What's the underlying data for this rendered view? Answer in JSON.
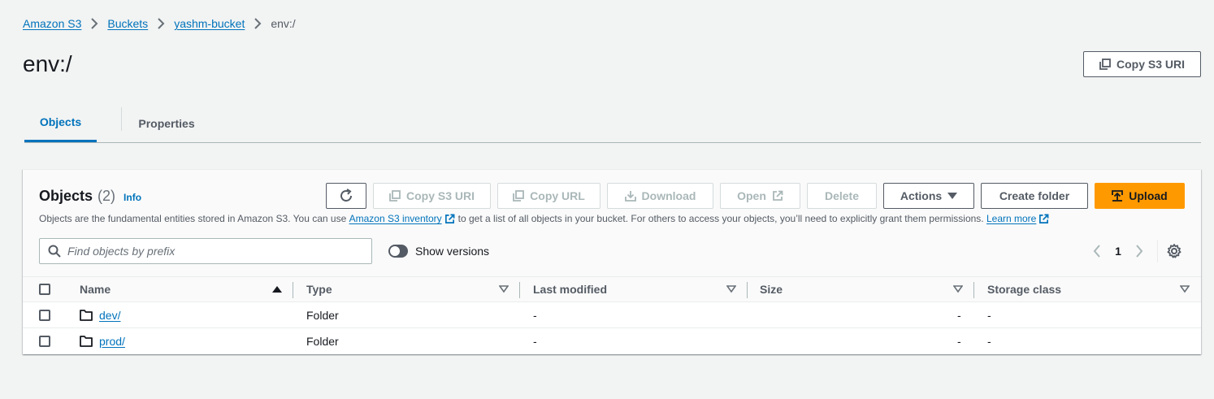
{
  "breadcrumbs": [
    {
      "label": "Amazon S3"
    },
    {
      "label": "Buckets"
    },
    {
      "label": "yashm-bucket"
    },
    {
      "label": "env:/"
    }
  ],
  "page": {
    "title": "env:/",
    "copy_s3_uri_label": "Copy S3 URI"
  },
  "tabs": [
    {
      "label": "Objects",
      "active": true
    },
    {
      "label": "Properties",
      "active": false
    }
  ],
  "objects_panel": {
    "title": "Objects",
    "count": "(2)",
    "info": "Info",
    "desc_prefix": "Objects are the fundamental entities stored in Amazon S3. You can use",
    "inventory_link": "Amazon S3 inventory",
    "desc_middle": "to get a list of all objects in your bucket. For others to access your objects, you’ll need to explicitly grant them permissions.",
    "learn_more": "Learn more",
    "buttons": {
      "copy_s3_uri": "Copy S3 URI",
      "copy_url": "Copy URL",
      "download": "Download",
      "open": "Open",
      "delete": "Delete",
      "actions": "Actions",
      "create_folder": "Create folder",
      "upload": "Upload"
    },
    "search_placeholder": "Find objects by prefix",
    "show_versions": "Show versions",
    "current_page": "1",
    "columns": [
      "Name",
      "Type",
      "Last modified",
      "Size",
      "Storage class"
    ],
    "rows": [
      {
        "name": "dev/",
        "type": "Folder",
        "last_modified": "-",
        "size": "-",
        "storage_class": "-"
      },
      {
        "name": "prod/",
        "type": "Folder",
        "last_modified": "-",
        "size": "-",
        "storage_class": "-"
      }
    ]
  },
  "colors": {
    "link": "#0073bb",
    "primary_button": "#ff9900",
    "background": "#f2f3f3"
  }
}
